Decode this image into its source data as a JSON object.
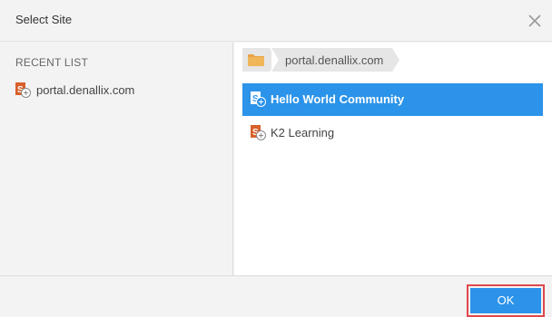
{
  "dialog": {
    "title": "Select Site"
  },
  "recent": {
    "heading": "RECENT LIST",
    "items": [
      {
        "label": "portal.denallix.com",
        "icon": "sharepoint-site-icon"
      }
    ]
  },
  "browser": {
    "breadcrumb": {
      "folder_icon": "folder-icon",
      "current": "portal.denallix.com"
    },
    "sites": [
      {
        "label": "Hello World Community",
        "selected": true,
        "icon": "sharepoint-site-icon"
      },
      {
        "label": "K2 Learning",
        "selected": false,
        "icon": "sharepoint-site-icon"
      }
    ]
  },
  "footer": {
    "ok_label": "OK"
  },
  "colors": {
    "accent": "#2b93e9",
    "highlight_border": "#e0474c",
    "folder": "#e8a445",
    "site_icon": "#d8602a"
  }
}
